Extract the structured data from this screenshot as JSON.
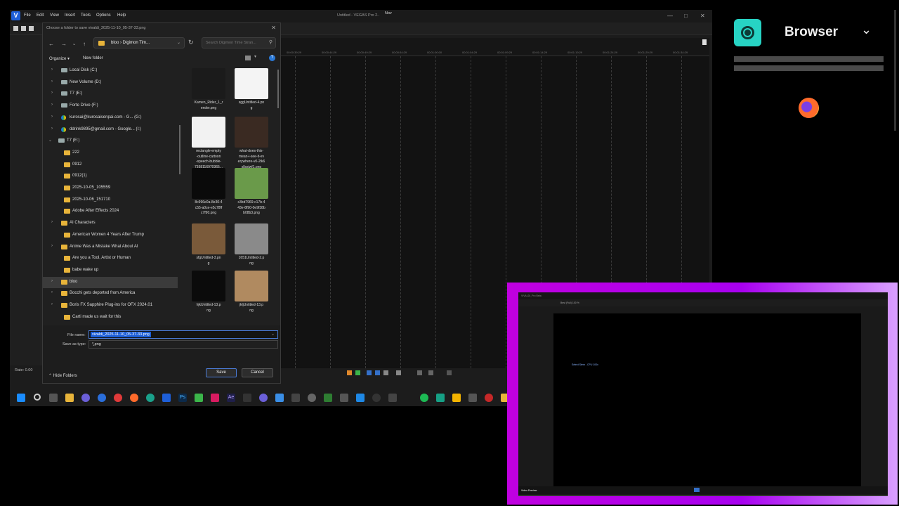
{
  "vegas": {
    "logo": "V",
    "menu": [
      "File",
      "Edit",
      "View",
      "Insert",
      "Tools",
      "Options",
      "Help"
    ],
    "title": "Untitled - VEGAS Pro 2..",
    "title_extra": "Nov",
    "rate": "Rate: 0.00",
    "ruler_ticks": [
      "00:00:39:29",
      "00:00:44:29",
      "00:00:49:29",
      "00:00:54:29",
      "00:01:00:00",
      "00:01:04:29",
      "00:01:09:29",
      "00:01:14:29",
      "00:01:19:29",
      "00:01:24:29",
      "00:01:29:29",
      "00:01:34:29"
    ]
  },
  "dialog": {
    "title": "Choose a folder to save vivaldi_2025-11-10_05-37-33.png",
    "address": "bloo  ›  Digimon Tim...",
    "search_placeholder": "Search Digimon Time Stran...",
    "organize": "Organize ▾",
    "new_folder": "New folder",
    "tree": [
      {
        "label": "Local Disk (C:)",
        "indent": 1,
        "chev": ">",
        "icon": "drive"
      },
      {
        "label": "New Volume (D:)",
        "indent": 1,
        "chev": ">",
        "icon": "drive"
      },
      {
        "label": "T7 (E:)",
        "indent": 1,
        "chev": ">",
        "icon": "drive"
      },
      {
        "label": "Forte Drive (F:)",
        "indent": 1,
        "chev": ">",
        "icon": "drive"
      },
      {
        "label": "kurosai@kurosaisenpai.com - G... (G:)",
        "indent": 1,
        "chev": ">",
        "icon": "gdrive"
      },
      {
        "label": "ddrink9895@gmail.com - Google... (I:)",
        "indent": 1,
        "chev": ">",
        "icon": "gdrive"
      },
      {
        "label": "T7 (E:)",
        "indent": 0,
        "chev": "⌄",
        "icon": "drive"
      },
      {
        "label": "222",
        "indent": 2,
        "chev": "",
        "icon": "folder"
      },
      {
        "label": "0912",
        "indent": 2,
        "chev": "",
        "icon": "folder"
      },
      {
        "label": "0912(1)",
        "indent": 2,
        "chev": "",
        "icon": "folder"
      },
      {
        "label": "2025-10-05_105559",
        "indent": 2,
        "chev": "",
        "icon": "folder"
      },
      {
        "label": "2025-10-06_151710",
        "indent": 2,
        "chev": "",
        "icon": "folder"
      },
      {
        "label": "Adobe After Effects 2024",
        "indent": 2,
        "chev": "",
        "icon": "folder"
      },
      {
        "label": "AI Characters",
        "indent": 1,
        "chev": ">",
        "icon": "folder"
      },
      {
        "label": "American Women 4 Years After Trump",
        "indent": 2,
        "chev": "",
        "icon": "folder"
      },
      {
        "label": "Anime Was a Mistake What About AI",
        "indent": 1,
        "chev": ">",
        "icon": "folder"
      },
      {
        "label": "Are you a Tool, Artist or Human",
        "indent": 2,
        "chev": "",
        "icon": "folder"
      },
      {
        "label": "babe wake up",
        "indent": 2,
        "chev": "",
        "icon": "folder"
      },
      {
        "label": "bloo",
        "indent": 1,
        "chev": ">",
        "icon": "folder",
        "selected": true
      },
      {
        "label": "Bocchi gets deported from America",
        "indent": 1,
        "chev": ">",
        "icon": "folder"
      },
      {
        "label": "Boris FX Sapphire Plug-ins for OFX 2024.01",
        "indent": 1,
        "chev": ">",
        "icon": "folder"
      },
      {
        "label": "Carti made us wait for this",
        "indent": 2,
        "chev": "",
        "icon": "folder"
      }
    ],
    "files": [
      {
        "name": "Kamen_Rider_1_render.png",
        "lines": [
          "Kamen_Rider_1_r",
          "ender.png"
        ],
        "thumb": "#1b1b1b"
      },
      {
        "name": "sggUntitled-4.png",
        "lines": [
          "sggUntitled-4.pn",
          "g"
        ],
        "thumb": "#f4f4f4"
      },
      {
        "name": "rectangle-empty-outline-cartoon-speech-bubble",
        "lines": [
          "rectangle-empty",
          "-outline-cartoon",
          "-speech-bubble-",
          "7358116970365..."
        ],
        "thumb": "#f2f2f2"
      },
      {
        "name": "what-does-this-mean-i-see-it-everywhere",
        "lines": [
          "what-does-this-",
          "mean-i-see-it-ev",
          "erywhere-v0-2tk6",
          "sllssjwf1.png"
        ],
        "thumb": "#3a2a22"
      },
      {
        "name": "8c996e0a-8e30",
        "lines": [
          "8c996e0a-8e30-4",
          "c55-a0ce-e5c78ff",
          "c7f90.png"
        ],
        "thumb": "#0a0a0a"
      },
      {
        "name": "c3bd7969-c17b",
        "lines": [
          "c3bd7969-c17b-4",
          "43e-8f90-0e9f38b",
          "b08b3.png"
        ],
        "thumb": "#6a9a4a"
      },
      {
        "name": "sfgUntitled-3.png",
        "lines": [
          "sfgUntitled-3.pn",
          "g"
        ],
        "thumb": "#7a5a3a"
      },
      {
        "name": "1651Untitled-2.png",
        "lines": [
          "1651Untitled-2.p",
          "ng"
        ],
        "thumb": "#8a8a8a"
      },
      {
        "name": "hjkUntitled-13.png",
        "lines": [
          "hjkUntitled-13.p",
          "ng"
        ],
        "thumb": "#0b0b0b"
      },
      {
        "name": "jkljUntitled-13.png",
        "lines": [
          "jkljUntitled-13.p",
          "ng"
        ],
        "thumb": "#b08a60"
      }
    ],
    "file_name_label": "File name:",
    "file_name_value": "vivaldi_2025-11-10_05-37-33.png",
    "save_as_type_label": "Save as type:",
    "save_as_type_value": "*.png",
    "hide_folders": "Hide Folders",
    "save": "Save",
    "cancel": "Cancel"
  },
  "right_panel": {
    "title": "Browser"
  },
  "pip": {
    "topbar": "VIVALDI_Pro Beta",
    "toolbar": "Best (Full)   100 %",
    "chip": "Select Stem - CPU 100x",
    "bottom": "Video Preview"
  },
  "colors": {
    "accent": "#1e5fd8",
    "folder": "#e8b43a",
    "teal": "#27d3c4",
    "magenta": "#c000e0"
  }
}
